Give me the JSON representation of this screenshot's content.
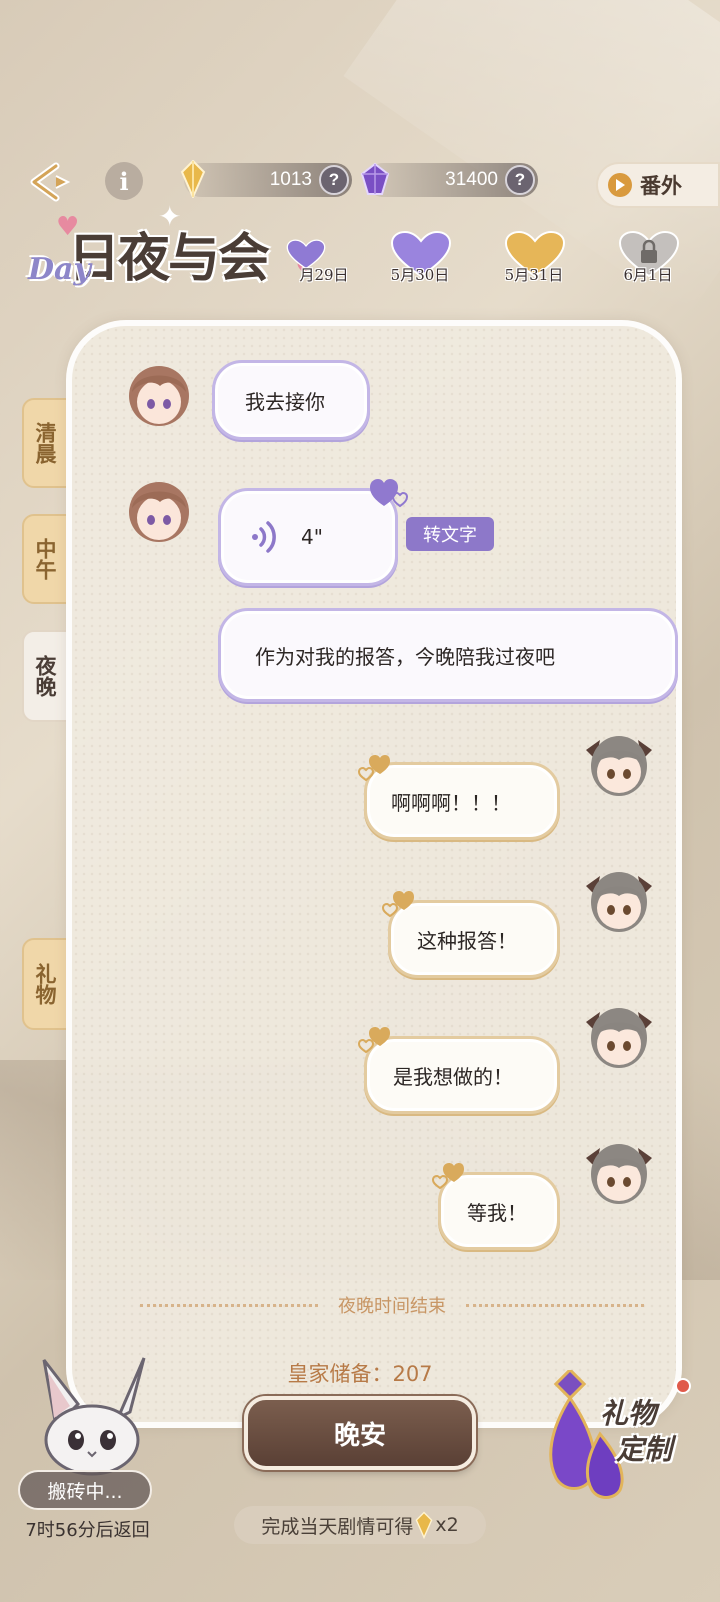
{
  "topbar": {
    "back_icon": "back-arrow-icon",
    "info_icon": "info-icon",
    "gold": {
      "value": "1013",
      "help": "?"
    },
    "purple": {
      "value": "31400",
      "help": "?"
    },
    "extra_label": "番外"
  },
  "logo": {
    "main": "日夜与会",
    "sub": "Day"
  },
  "dates": [
    {
      "label": "月29日",
      "state": "purple"
    },
    {
      "label": "5月30日",
      "state": "purple"
    },
    {
      "label": "5月31日",
      "state": "gold"
    },
    {
      "label": "6月1日",
      "state": "locked"
    }
  ],
  "side_tabs": [
    {
      "label": "清晨",
      "active": false
    },
    {
      "label": "中午",
      "active": false
    },
    {
      "label": "夜晚",
      "active": true
    },
    {
      "label": "礼物",
      "active": false
    }
  ],
  "messages": [
    {
      "sender": "him",
      "text": "我去接你"
    },
    {
      "sender": "him",
      "type": "voice",
      "duration": "4\"",
      "action": "转文字"
    },
    {
      "sender": "him",
      "text": "作为对我的报答，今晚陪我过夜吧"
    },
    {
      "sender": "me",
      "text": "啊啊啊！！！"
    },
    {
      "sender": "me",
      "text": "这种报答！"
    },
    {
      "sender": "me",
      "text": "是我想做的！"
    },
    {
      "sender": "me",
      "text": "等我！"
    }
  ],
  "end_text": "夜晚时间结束",
  "reserve": "皇家储备：207",
  "goodnight_label": "晚安",
  "reward_note": {
    "prefix": "完成当天剧情可得",
    "suffix": "x2"
  },
  "bunny": {
    "status": "搬砖中...",
    "return_time": "7时56分后返回"
  },
  "gift_custom": {
    "line1": "礼物",
    "line2": "定制"
  },
  "colors": {
    "accent_purple": "#8d78c9",
    "accent_gold": "#d99a3e",
    "button_brown": "#6b4f42"
  }
}
